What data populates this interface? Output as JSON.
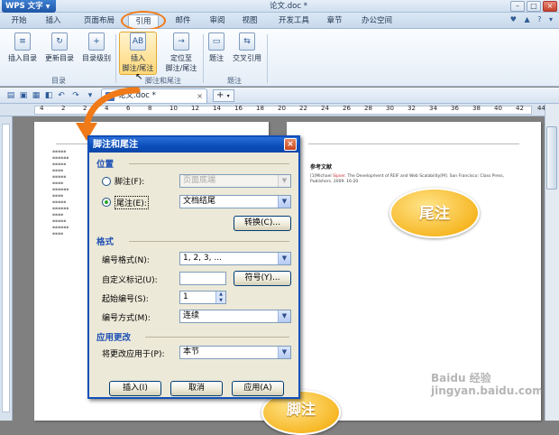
{
  "titlebar": {
    "app_button": "WPS 文字",
    "doc_title": "论文.doc *"
  },
  "tabs": [
    "开始",
    "插入",
    "页面布局",
    "引用",
    "邮件",
    "审阅",
    "视图",
    "开发工具",
    "章节",
    "办公空间"
  ],
  "active_tab": "引用",
  "ribbon": {
    "buttons": {
      "insert_toc": "插入目录",
      "update_toc": "更新目录",
      "toc_level": "目录级别",
      "insert_footnote_1": "插入",
      "insert_footnote_2": "脚注/尾注",
      "goto_footnote_1": "定位至",
      "goto_footnote_2": "脚注/尾注",
      "caption": "题注",
      "cross_ref": "交叉引用"
    },
    "groups": {
      "toc": "目录",
      "footnotes": "脚注和尾注",
      "captions": "题注"
    }
  },
  "toolbar": {
    "doc_tab": "论文.doc *",
    "add_tab": "+"
  },
  "ruler": {
    "numbers": [
      "4",
      "2",
      "2",
      "4",
      "6",
      "8",
      "10",
      "12",
      "14",
      "16",
      "18",
      "20",
      "22",
      "24",
      "26",
      "28",
      "30",
      "32",
      "34",
      "36",
      "38",
      "40",
      "42",
      "44"
    ]
  },
  "document": {
    "ref_title": "参考文献",
    "ref_line1_prefix": "[1]Michael",
    "ref_line1_red": "Sipser.",
    "ref_line1_rest": "The Development of REIF and Web Scalability[M]. San Francisco: Class Press,",
    "ref_line2": "Publishers. 2009. 16-20"
  },
  "callouts": {
    "endnote": "尾注",
    "footnote": "脚注"
  },
  "dialog": {
    "title": "脚注和尾注",
    "close": "×",
    "location_section": "位置",
    "footnote_label": "脚注(F):",
    "footnote_value": "页面底端",
    "endnote_label": "尾注(E):",
    "endnote_value": "文档结尾",
    "convert_button": "转换(C)...",
    "format_section": "格式",
    "number_format_label": "编号格式(N):",
    "number_format_value": "1, 2, 3, ...",
    "custom_mark_label": "自定义标记(U):",
    "custom_mark_value": "",
    "symbol_button": "符号(Y)...",
    "start_at_label": "起始编号(S):",
    "start_at_value": "1",
    "numbering_label": "编号方式(M):",
    "numbering_value": "连续",
    "apply_section": "应用更改",
    "apply_to_label": "将更改应用于(P):",
    "apply_to_value": "本节",
    "insert_button": "插入(I)",
    "cancel_button": "取消",
    "apply_button": "应用(A)",
    "footnote_selected": false,
    "endnote_selected": true
  },
  "watermark": "Baidu 经验 jingyan.baidu.com",
  "colors": {
    "accent": "#f07a18",
    "dialog_title": "#0a4cb9",
    "section": "#1e4fb3",
    "callout": "#f6b520"
  }
}
